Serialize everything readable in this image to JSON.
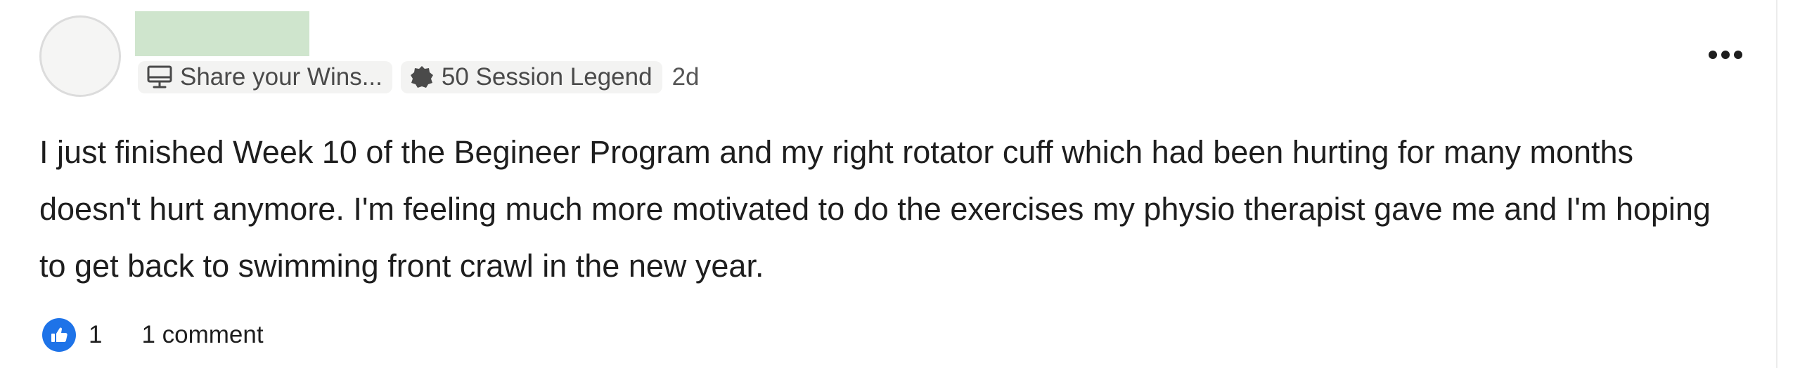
{
  "post": {
    "author_name": "",
    "category_chip": {
      "label": "Share your Wins...",
      "icon": "monitor-icon"
    },
    "badge_chip": {
      "label": "50 Session Legend",
      "icon": "badge-icon"
    },
    "timestamp": "2d",
    "body": "I just finished Week 10 of the Begineer Program and my right rotator cuff which had been hurting for many months doesn't hurt anymore. I'm feeling much more motivated to do the exercises my physio therapist gave me and I'm hoping to get back to swimming front crawl in the new year.",
    "likes": {
      "count": "1",
      "icon": "thumbs-up-icon"
    },
    "comments_label": "1 comment",
    "menu_icon": "more-horizontal-icon"
  },
  "colors": {
    "like_accent": "#1e73e8",
    "name_placeholder": "#cfe5cd",
    "chip_background": "#f3f3f2"
  }
}
